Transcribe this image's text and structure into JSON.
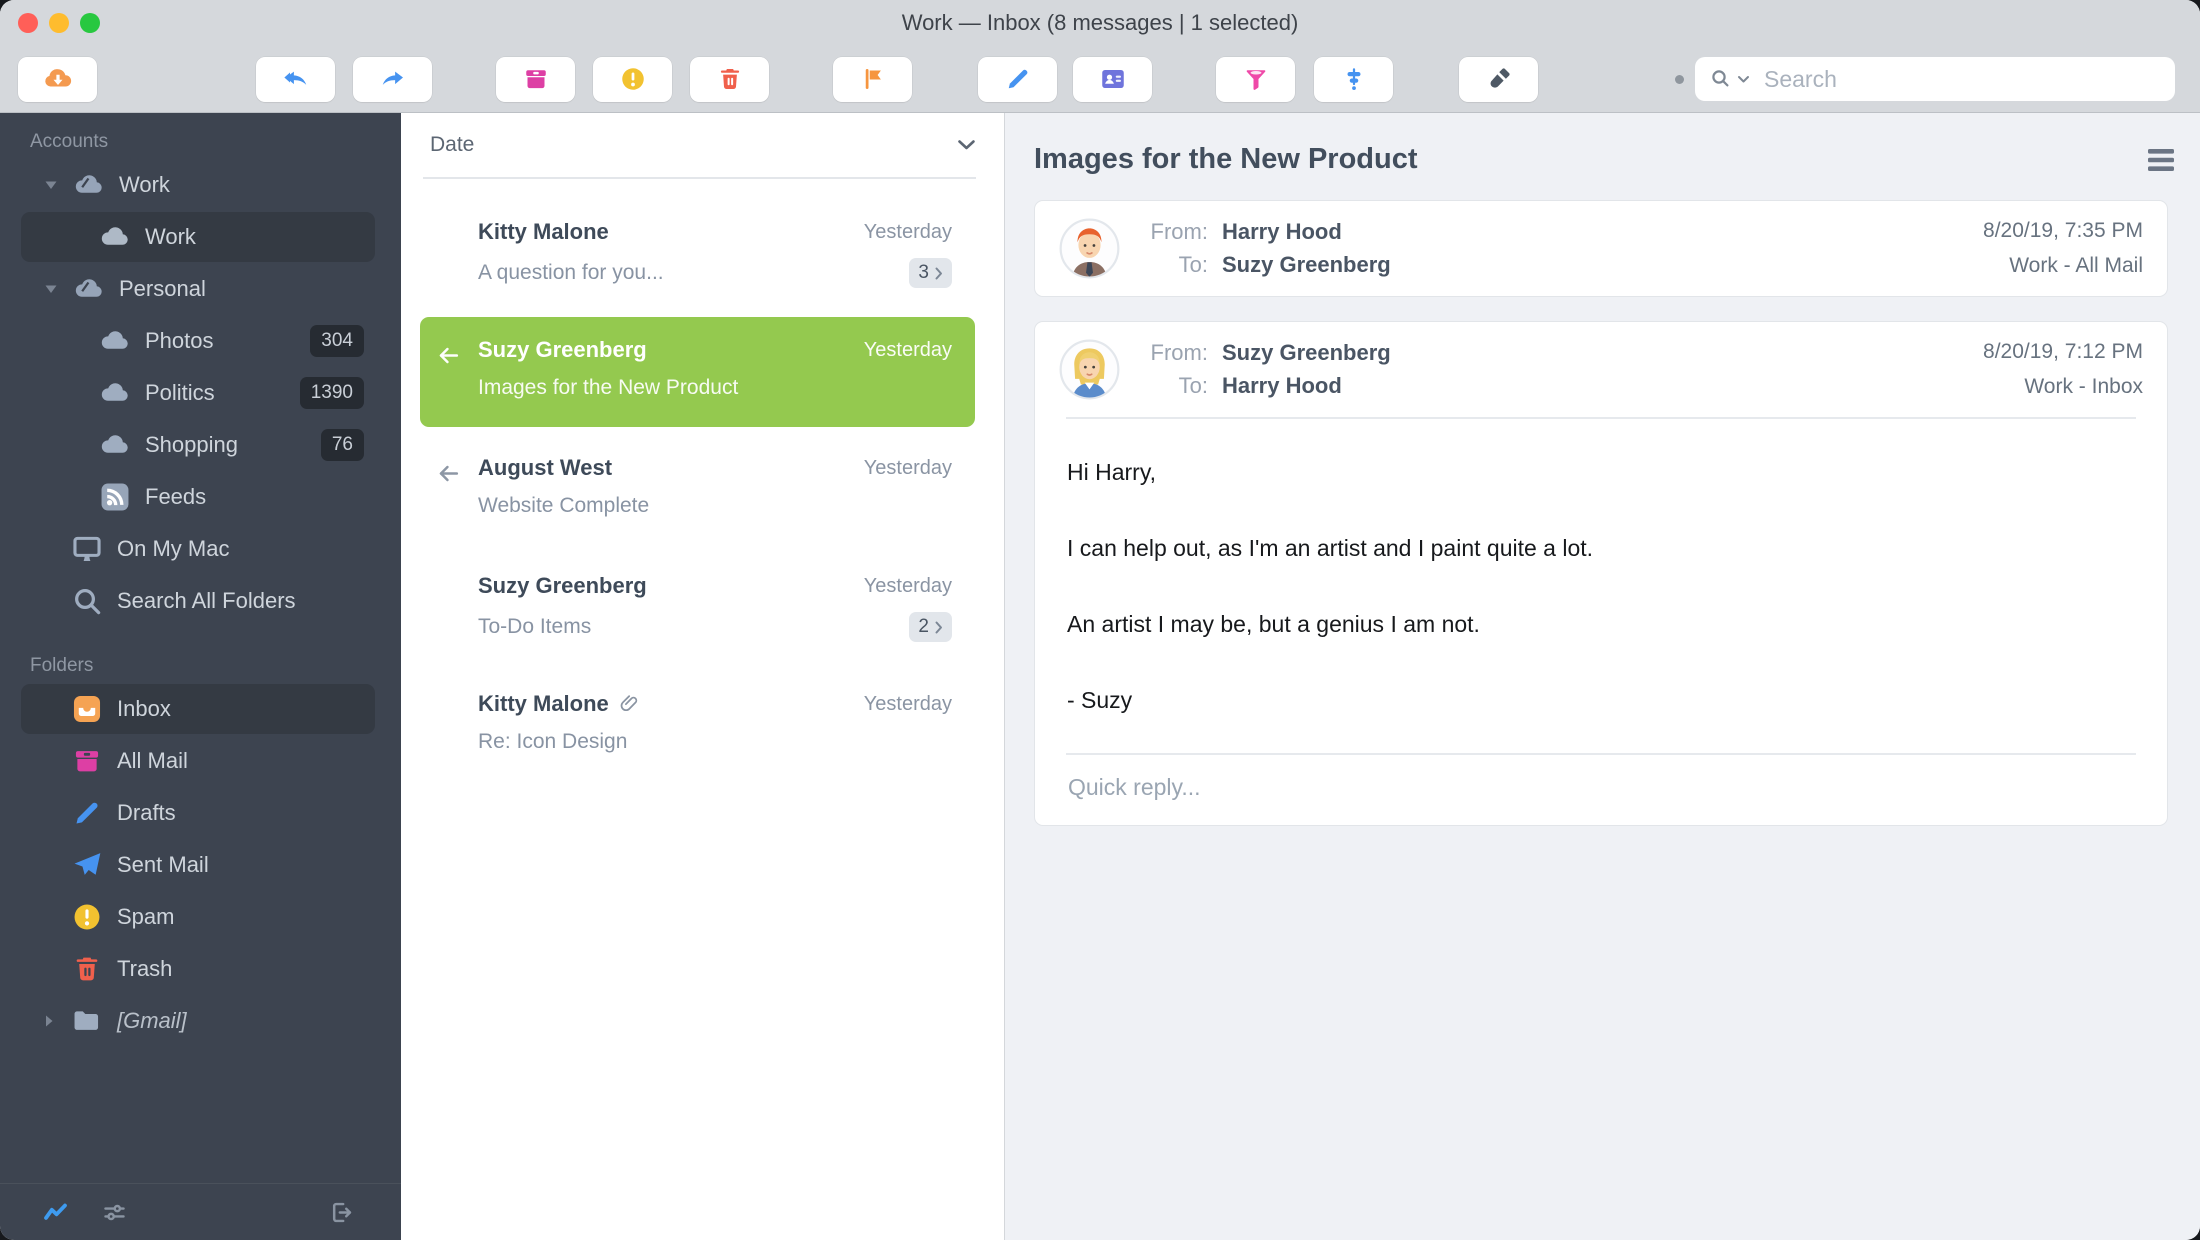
{
  "titlebar": {
    "title": "Work — Inbox (8 messages | 1 selected)"
  },
  "toolbar": {
    "search": {
      "placeholder": "Search"
    },
    "buttons": [
      {
        "name": "cloud-download",
        "color": "#F49A50"
      },
      {
        "name": "reply-all",
        "color": "#4693F0"
      },
      {
        "name": "forward",
        "color": "#4693F0"
      },
      {
        "name": "archive",
        "color": "#DD3FA4"
      },
      {
        "name": "report-spam",
        "color": "#F2C230"
      },
      {
        "name": "trash",
        "color": "#F0604C"
      },
      {
        "name": "flag",
        "color": "#F6953F"
      },
      {
        "name": "compose",
        "color": "#4693F0"
      },
      {
        "name": "contact-card",
        "color": "#6F74DC"
      },
      {
        "name": "filter-funnel",
        "color": "#EF49A8"
      },
      {
        "name": "organize",
        "color": "#4693F0"
      },
      {
        "name": "theme-brush",
        "color": "#4E5965"
      }
    ]
  },
  "sidebar": {
    "accounts_header": "Accounts",
    "accounts": [
      {
        "label": "Work"
      },
      {
        "label": "Work"
      },
      {
        "label": "Personal"
      },
      {
        "label": "Photos",
        "badge": "304"
      },
      {
        "label": "Politics",
        "badge": "1390"
      },
      {
        "label": "Shopping",
        "badge": "76"
      },
      {
        "label": "Feeds"
      },
      {
        "label": "On My Mac"
      },
      {
        "label": "Search All Folders"
      }
    ],
    "folders_header": "Folders",
    "folders": [
      {
        "label": "Inbox"
      },
      {
        "label": "All Mail"
      },
      {
        "label": "Drafts"
      },
      {
        "label": "Sent Mail"
      },
      {
        "label": "Spam"
      },
      {
        "label": "Trash"
      },
      {
        "label": "[Gmail]"
      }
    ]
  },
  "message_list": {
    "sort_label": "Date",
    "items": [
      {
        "sender": "Kitty Malone",
        "subject": "A question for you...",
        "date": "Yesterday",
        "thread_count": "3"
      },
      {
        "sender": "Suzy Greenberg",
        "subject": "Images for the New Product",
        "date": "Yesterday"
      },
      {
        "sender": "August West",
        "subject": "Website Complete",
        "date": "Yesterday"
      },
      {
        "sender": "Suzy Greenberg",
        "subject": "To-Do Items",
        "date": "Yesterday",
        "thread_count": "2"
      },
      {
        "sender": "Kitty Malone",
        "subject": "Re: Icon Design",
        "date": "Yesterday"
      }
    ]
  },
  "reading_pane": {
    "title": "Images for the New Product",
    "messages": [
      {
        "from_label": "From:",
        "from": "Harry Hood",
        "to_label": "To:",
        "to": "Suzy Greenberg",
        "datetime": "8/20/19, 7:35 PM",
        "folder": "Work - All Mail"
      },
      {
        "from_label": "From:",
        "from": "Suzy Greenberg",
        "to_label": "To:",
        "to": "Harry Hood",
        "datetime": "8/20/19, 7:12 PM",
        "folder": "Work - Inbox",
        "body": [
          "Hi Harry,",
          "I can help out, as I'm an artist and I paint quite a lot.",
          "An artist I may be, but a genius I am not.",
          "- Suzy"
        ],
        "quick_reply_placeholder": "Quick reply..."
      }
    ]
  },
  "colors": {
    "selection_green": "#94C94F",
    "sidebar_bg": "#3D4450",
    "chrome_bg": "#D5D8DC",
    "reading_bg": "#EFF1F5",
    "badge_dark_bg": "#262B32",
    "accent_blue": "#4693F0",
    "accent_orange": "#F5A353",
    "accent_magenta": "#DD3FA4",
    "accent_yellow": "#F2C230",
    "accent_red": "#F0604C"
  }
}
